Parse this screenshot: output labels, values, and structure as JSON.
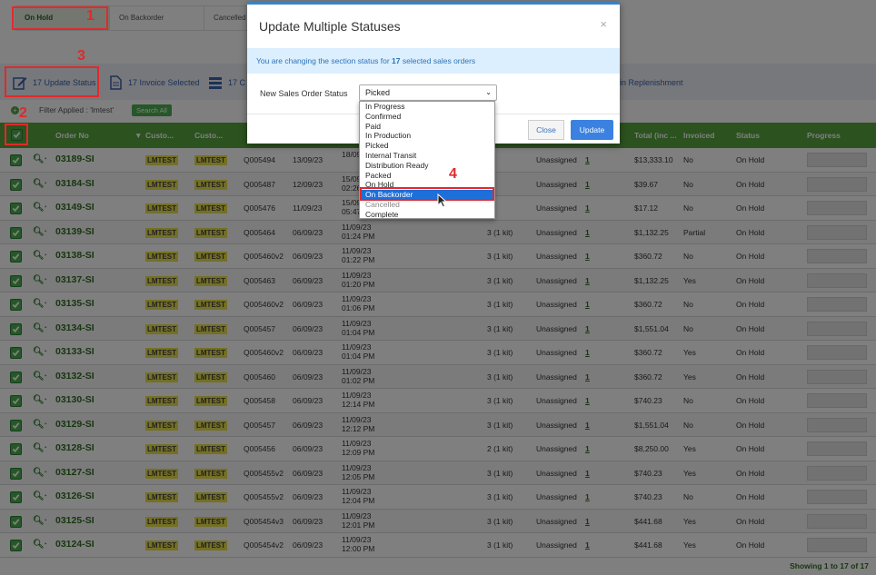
{
  "filter_tabs": [
    "On Hold",
    "On Backorder",
    "Cancelled"
  ],
  "toolbar": {
    "update_status": "17 Update Status",
    "invoice_selected": "17 Invoice Selected",
    "third_partial": "17 C",
    "replenishment_partial": "in Replenishment"
  },
  "filter": {
    "text": "Filter Applied : 'lmtest'",
    "search_all": "Search All"
  },
  "table": {
    "headers": [
      "Order No",
      "Custo...",
      "Custo...",
      "Total (inc ...",
      "Invoiced",
      "Status",
      "Progress"
    ],
    "rows": [
      {
        "order": "03189-SI",
        "c1": "LMTEST",
        "c2": "LMTEST",
        "quote": "Q005494",
        "date": "13/09/23",
        "dt1": "18/09",
        "dt2": "",
        "kits": "",
        "assign": "Unassigned",
        "inv": "1",
        "total": "$13,333.10",
        "invoiced": "No",
        "status": "On Hold"
      },
      {
        "order": "03184-SI",
        "c1": "LMTEST",
        "c2": "LMTEST",
        "quote": "Q005487",
        "date": "12/09/23",
        "dt1": "15/09",
        "dt2": "02:26",
        "kits": "",
        "assign": "Unassigned",
        "inv": "1",
        "total": "$39.67",
        "invoiced": "No",
        "status": "On Hold"
      },
      {
        "order": "03149-SI",
        "c1": "LMTEST",
        "c2": "LMTEST",
        "quote": "Q005476",
        "date": "11/09/23",
        "dt1": "15/09",
        "dt2": "05:47",
        "kits": "",
        "assign": "Unassigned",
        "inv": "1",
        "total": "$17.12",
        "invoiced": "No",
        "status": "On Hold"
      },
      {
        "order": "03139-SI",
        "c1": "LMTEST",
        "c2": "LMTEST",
        "quote": "Q005464",
        "date": "06/09/23",
        "dt1": "11/09/23",
        "dt2": "01:24 PM",
        "kits": "3 (1 kit)",
        "assign": "Unassigned",
        "inv": "1",
        "total": "$1,132.25",
        "invoiced": "Partial",
        "status": "On Hold"
      },
      {
        "order": "03138-SI",
        "c1": "LMTEST",
        "c2": "LMTEST",
        "quote": "Q005460v2",
        "date": "06/09/23",
        "dt1": "11/09/23",
        "dt2": "01:22 PM",
        "kits": "3 (1 kit)",
        "assign": "Unassigned",
        "inv": "1",
        "total": "$360.72",
        "invoiced": "No",
        "status": "On Hold"
      },
      {
        "order": "03137-SI",
        "c1": "LMTEST",
        "c2": "LMTEST",
        "quote": "Q005463",
        "date": "06/09/23",
        "dt1": "11/09/23",
        "dt2": "01:20 PM",
        "kits": "3 (1 kit)",
        "assign": "Unassigned",
        "inv": "1",
        "total": "$1,132.25",
        "invoiced": "Yes",
        "status": "On Hold"
      },
      {
        "order": "03135-SI",
        "c1": "LMTEST",
        "c2": "LMTEST",
        "quote": "Q005460v2",
        "date": "06/09/23",
        "dt1": "11/09/23",
        "dt2": "01:06 PM",
        "kits": "3 (1 kit)",
        "assign": "Unassigned",
        "inv": "1",
        "total": "$360.72",
        "invoiced": "No",
        "status": "On Hold"
      },
      {
        "order": "03134-SI",
        "c1": "LMTEST",
        "c2": "LMTEST",
        "quote": "Q005457",
        "date": "06/09/23",
        "dt1": "11/09/23",
        "dt2": "01:04 PM",
        "kits": "3 (1 kit)",
        "assign": "Unassigned",
        "inv": "1",
        "total": "$1,551.04",
        "invoiced": "No",
        "status": "On Hold"
      },
      {
        "order": "03133-SI",
        "c1": "LMTEST",
        "c2": "LMTEST",
        "quote": "Q005460v2",
        "date": "06/09/23",
        "dt1": "11/09/23",
        "dt2": "01:04 PM",
        "kits": "3 (1 kit)",
        "assign": "Unassigned",
        "inv": "1",
        "total": "$360.72",
        "invoiced": "Yes",
        "status": "On Hold"
      },
      {
        "order": "03132-SI",
        "c1": "LMTEST",
        "c2": "LMTEST",
        "quote": "Q005460",
        "date": "06/09/23",
        "dt1": "11/09/23",
        "dt2": "01:02 PM",
        "kits": "3 (1 kit)",
        "assign": "Unassigned",
        "inv": "1",
        "total": "$360.72",
        "invoiced": "Yes",
        "status": "On Hold"
      },
      {
        "order": "03130-SI",
        "c1": "LMTEST",
        "c2": "LMTEST",
        "quote": "Q005458",
        "date": "06/09/23",
        "dt1": "11/09/23",
        "dt2": "12:14 PM",
        "kits": "3 (1 kit)",
        "assign": "Unassigned",
        "inv": "1",
        "total": "$740.23",
        "invoiced": "No",
        "status": "On Hold"
      },
      {
        "order": "03129-SI",
        "c1": "LMTEST",
        "c2": "LMTEST",
        "quote": "Q005457",
        "date": "06/09/23",
        "dt1": "11/09/23",
        "dt2": "12:12 PM",
        "kits": "3 (1 kit)",
        "assign": "Unassigned",
        "inv": "1",
        "total": "$1,551.04",
        "invoiced": "No",
        "status": "On Hold"
      },
      {
        "order": "03128-SI",
        "c1": "LMTEST",
        "c2": "LMTEST",
        "quote": "Q005456",
        "date": "06/09/23",
        "dt1": "11/09/23",
        "dt2": "12:09 PM",
        "kits": "2 (1 kit)",
        "assign": "Unassigned",
        "inv": "1",
        "total": "$8,250.00",
        "invoiced": "Yes",
        "status": "On Hold"
      },
      {
        "order": "03127-SI",
        "c1": "LMTEST",
        "c2": "LMTEST",
        "quote": "Q005455v2",
        "date": "06/09/23",
        "dt1": "11/09/23",
        "dt2": "12:05 PM",
        "kits": "3 (1 kit)",
        "assign": "Unassigned",
        "inv": "1",
        "total": "$740.23",
        "invoiced": "Yes",
        "status": "On Hold"
      },
      {
        "order": "03126-SI",
        "c1": "LMTEST",
        "c2": "LMTEST",
        "quote": "Q005455v2",
        "date": "06/09/23",
        "dt1": "11/09/23",
        "dt2": "12:04 PM",
        "kits": "3 (1 kit)",
        "assign": "Unassigned",
        "inv": "1",
        "total": "$740.23",
        "invoiced": "No",
        "status": "On Hold"
      },
      {
        "order": "03125-SI",
        "c1": "LMTEST",
        "c2": "LMTEST",
        "quote": "Q005454v3",
        "date": "06/09/23",
        "dt1": "11/09/23",
        "dt2": "12:01 PM",
        "kits": "3 (1 kit)",
        "assign": "Unassigned",
        "inv": "1",
        "total": "$441.68",
        "invoiced": "Yes",
        "status": "On Hold"
      },
      {
        "order": "03124-SI",
        "c1": "LMTEST",
        "c2": "LMTEST",
        "quote": "Q005454v2",
        "date": "06/09/23",
        "dt1": "11/09/23",
        "dt2": "12:00 PM",
        "kits": "3 (1 kit)",
        "assign": "Unassigned",
        "inv": "1",
        "total": "$441.68",
        "invoiced": "Yes",
        "status": "On Hold"
      }
    ]
  },
  "footer": "Showing 1 to 17 of 17",
  "modal": {
    "title": "Update Multiple Statuses",
    "close_glyph": "×",
    "info_pre": "You are changing the section status for ",
    "info_count": "17",
    "info_post": " selected sales orders",
    "field_label": "New Sales Order Status",
    "field_value": "Picked",
    "close_button": "Close",
    "update_button": "Update"
  },
  "dropdown": {
    "options": [
      "In Progress",
      "Confirmed",
      "Paid",
      "In Production",
      "Picked",
      "Internal Transit",
      "Distribution Ready",
      "Packed",
      "On Hold",
      "On Backorder",
      "Cancelled",
      "Complete"
    ],
    "selected": "On Backorder"
  },
  "annotations": [
    "1",
    "2",
    "3",
    "4"
  ],
  "colors": {
    "header_green": "#56a53f",
    "annotation_red": "#e02a2a",
    "modal_blue": "#3b82c4",
    "highlight_yellow": "#e8e04a"
  }
}
